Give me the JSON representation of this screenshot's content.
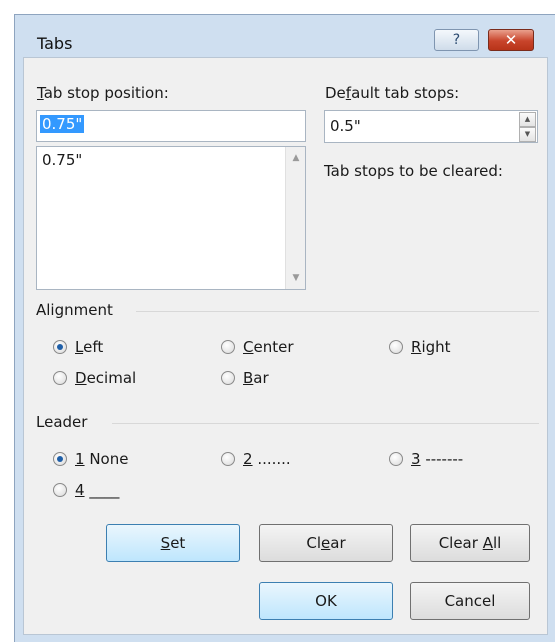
{
  "dialog": {
    "title": "Tabs",
    "help_glyph": "?",
    "close_glyph": "✕"
  },
  "tab_stop_position": {
    "label_mnemonic": "T",
    "label_rest": "ab stop position:",
    "value": "0.75\"",
    "list_items": [
      "0.75\""
    ]
  },
  "default_tab_stops": {
    "label_pre": "De",
    "label_mnemonic": "f",
    "label_post": "ault tab stops:",
    "value": "0.5\""
  },
  "to_be_cleared": {
    "label": "Tab stops to be cleared:"
  },
  "alignment": {
    "label": "Alignment",
    "options": [
      {
        "mnemonic": "L",
        "rest": "eft",
        "checked": true
      },
      {
        "mnemonic": "C",
        "rest": "enter",
        "checked": false
      },
      {
        "mnemonic": "R",
        "rest": "ight",
        "checked": false
      },
      {
        "mnemonic": "D",
        "rest": "ecimal",
        "checked": false
      },
      {
        "mnemonic": "B",
        "rest": "ar",
        "checked": false
      }
    ]
  },
  "leader": {
    "label": "Leader",
    "options": [
      {
        "mnemonic": "1",
        "rest": " None",
        "checked": true
      },
      {
        "mnemonic": "2",
        "rest": " .......",
        "checked": false
      },
      {
        "mnemonic": "3",
        "rest": " -------",
        "checked": false
      },
      {
        "mnemonic": "4",
        "rest": " ____",
        "checked": false
      }
    ]
  },
  "buttons": {
    "set": {
      "mnemonic": "S",
      "rest": "et"
    },
    "clear": {
      "pre": "Cl",
      "mnemonic": "e",
      "post": "ar"
    },
    "clear_all": {
      "pre": "Clear ",
      "mnemonic": "A",
      "post": "ll"
    },
    "ok": "OK",
    "cancel": "Cancel"
  }
}
